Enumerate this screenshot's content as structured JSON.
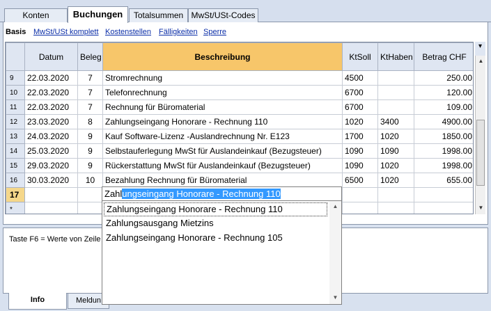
{
  "tabs": [
    "Konten",
    "Buchungen",
    "Totalsummen",
    "MwSt/USt-Codes"
  ],
  "views": {
    "active": "Basis",
    "links": [
      "MwSt/USt komplett",
      "Kostenstellen",
      "Fälligkeiten",
      "Sperre"
    ]
  },
  "columns": {
    "datum": "Datum",
    "beleg": "Beleg",
    "beschreibung": "Beschreibung",
    "ktsoll": "KtSoll",
    "kthaben": "KtHaben",
    "betrag": "Betrag CHF"
  },
  "corner_mark": "▾",
  "rows": [
    {
      "nr": "9",
      "datum": "22.03.2020",
      "beleg": "7",
      "beschreibung": "Stromrechnung",
      "ktsoll": "4500",
      "kthaben": "",
      "betrag": "250.00"
    },
    {
      "nr": "10",
      "datum": "22.03.2020",
      "beleg": "7",
      "beschreibung": "Telefonrechnung",
      "ktsoll": "6700",
      "kthaben": "",
      "betrag": "120.00"
    },
    {
      "nr": "11",
      "datum": "22.03.2020",
      "beleg": "7",
      "beschreibung": "Rechnung für Büromaterial",
      "ktsoll": "6700",
      "kthaben": "",
      "betrag": "109.00"
    },
    {
      "nr": "12",
      "datum": "23.03.2020",
      "beleg": "8",
      "beschreibung": "Zahlungseingang Honorare - Rechnung 110",
      "ktsoll": "1020",
      "kthaben": "3400",
      "betrag": "4900.00"
    },
    {
      "nr": "13",
      "datum": "24.03.2020",
      "beleg": "9",
      "beschreibung": "Kauf Software-Lizenz -Auslandrechnung Nr. E123",
      "ktsoll": "1700",
      "kthaben": "1020",
      "betrag": "1850.00"
    },
    {
      "nr": "14",
      "datum": "25.03.2020",
      "beleg": "9",
      "beschreibung": "Selbstauferlegung MwSt für Auslandeinkauf (Bezugsteuer)",
      "ktsoll": "1090",
      "kthaben": "1090",
      "betrag": "1998.00"
    },
    {
      "nr": "15",
      "datum": "29.03.2020",
      "beleg": "9",
      "beschreibung": "Rückerstattung MwSt für Auslandeinkauf (Bezugsteuer)",
      "ktsoll": "1090",
      "kthaben": "1020",
      "betrag": "1998.00"
    },
    {
      "nr": "16",
      "datum": "30.03.2020",
      "beleg": "10",
      "beschreibung": "Bezahlung Rechnung für Büromaterial",
      "ktsoll": "6500",
      "kthaben": "1020",
      "betrag": "655.00"
    },
    {
      "nr": "17",
      "datum": "",
      "beleg": "",
      "beschreibung": "",
      "ktsoll": "",
      "kthaben": "",
      "betrag": ""
    },
    {
      "nr": "*",
      "datum": "",
      "beleg": "",
      "beschreibung": "",
      "ktsoll": "",
      "kthaben": "",
      "betrag": ""
    }
  ],
  "editor": {
    "typed": "Zahl",
    "completion": "ungseingang Honorare - Rechnung 110"
  },
  "suggestions": [
    "Zahlungseingang Honorare - Rechnung 110",
    "Zahlungsausgang Mietzins",
    "Zahlungseingang Honorare - Rechnung 105"
  ],
  "info": {
    "text": "Taste F6 = Werte von Zeile"
  },
  "bottom_tabs": [
    "Info",
    "Meldun"
  ],
  "colors": {
    "selected_header": "#f7c66a",
    "selection_highlight": "#3399ff",
    "link": "#0b2ea8"
  }
}
